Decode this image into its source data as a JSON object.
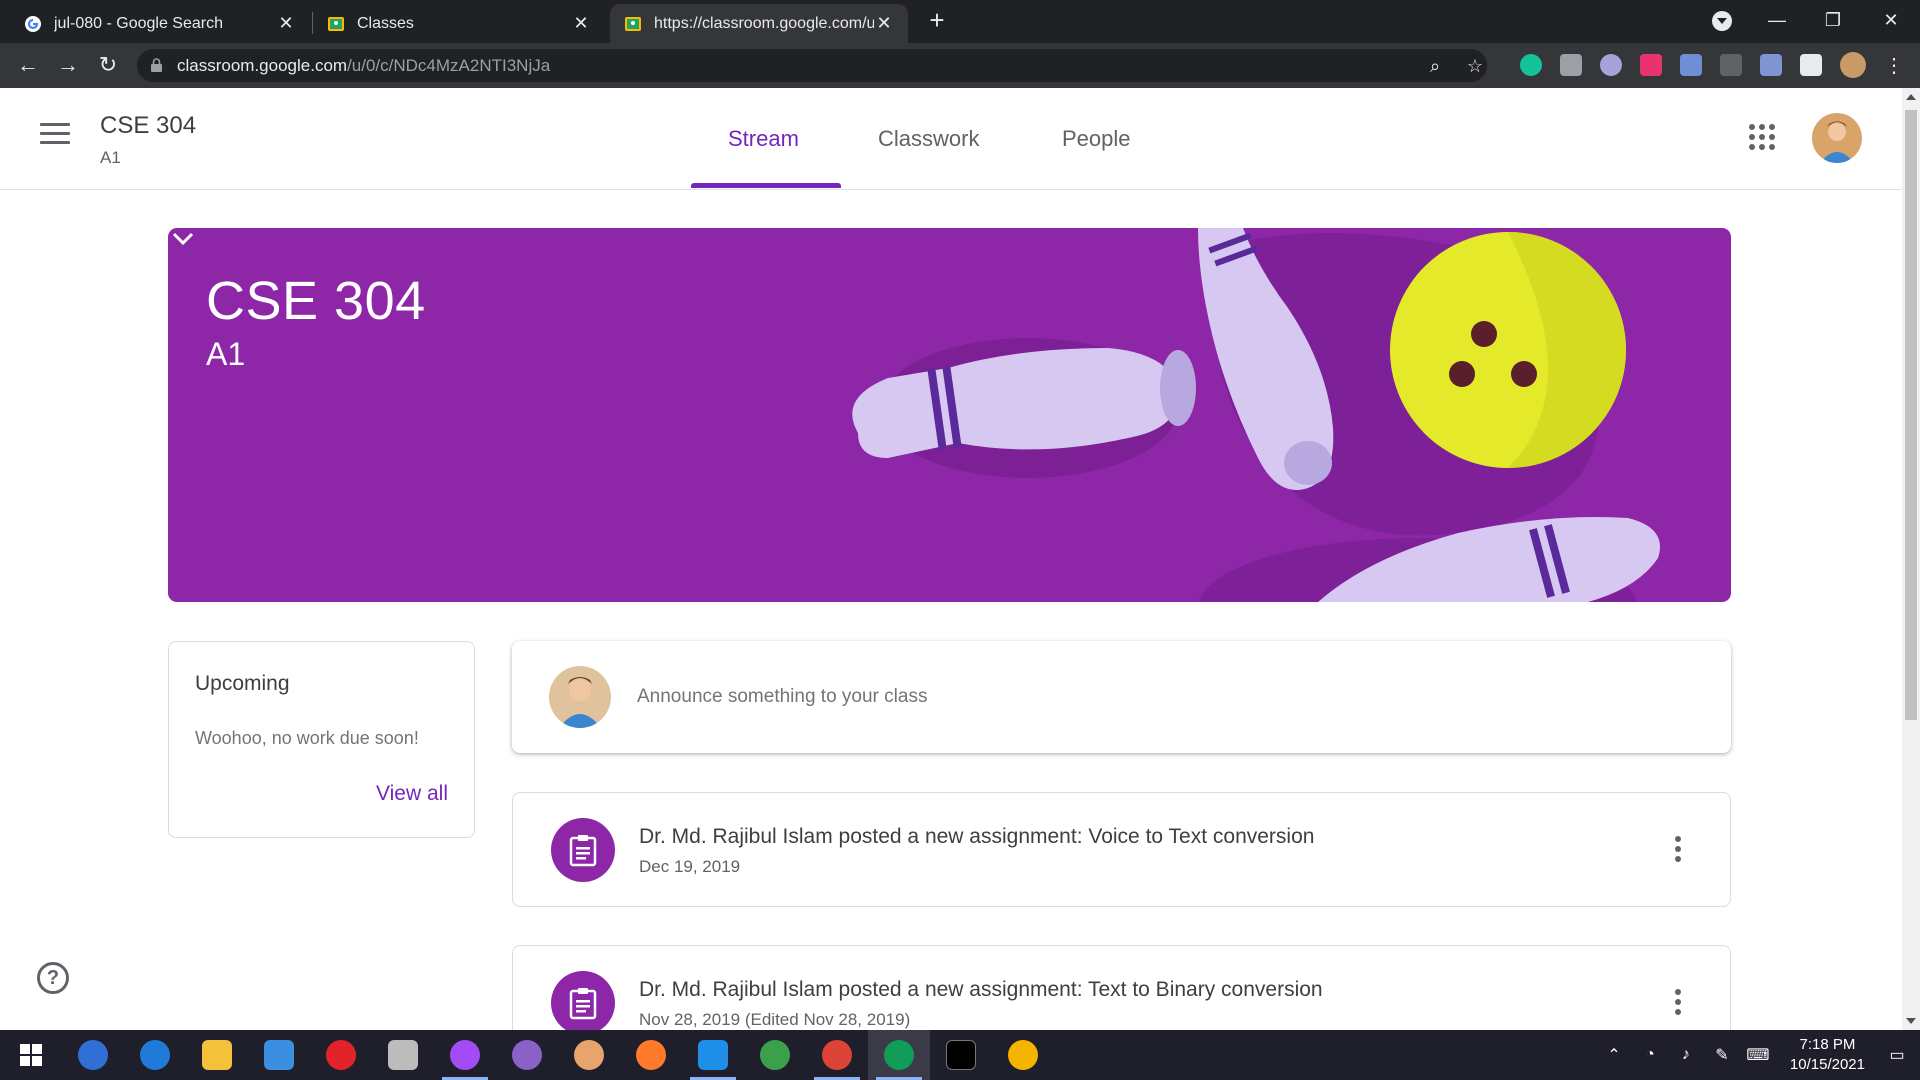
{
  "browser": {
    "tabs": [
      {
        "title": "jul-080 - Google Search",
        "icon": "google-icon",
        "active": false
      },
      {
        "title": "Classes",
        "icon": "classroom-icon",
        "active": false
      },
      {
        "title": "https://classroom.google.com/u/",
        "icon": "classroom-icon",
        "active": true
      }
    ],
    "new_tab": "+",
    "url_host": "classroom.google.com",
    "url_path": "/u/0/c/NDc4MzA2NTI3NjJa"
  },
  "header": {
    "class_name": "CSE 304",
    "section": "A1",
    "tabs": [
      "Stream",
      "Classwork",
      "People"
    ],
    "active_tab": "Stream"
  },
  "banner": {
    "title": "CSE 304",
    "section": "A1",
    "color": "#8d27a8"
  },
  "upcoming": {
    "title": "Upcoming",
    "empty_text": "Woohoo, no work due soon!",
    "view_all": "View all"
  },
  "announce": {
    "placeholder": "Announce something to your class"
  },
  "posts": [
    {
      "title": "Dr. Md. Rajibul Islam posted a new assignment: Voice to Text conversion",
      "date": "Dec 19, 2019",
      "icon": "assignment-icon"
    },
    {
      "title": "Dr. Md. Rajibul Islam posted a new assignment: Text to Binary conversion",
      "date": "Nov 28, 2019 (Edited Nov 28, 2019)",
      "icon": "assignment-icon"
    }
  ],
  "taskbar": {
    "time": "7:18 PM",
    "date": "10/15/2021"
  },
  "colors": {
    "accent": "#7627bb",
    "banner": "#8d27a8",
    "ball": "#e4ea2a"
  }
}
